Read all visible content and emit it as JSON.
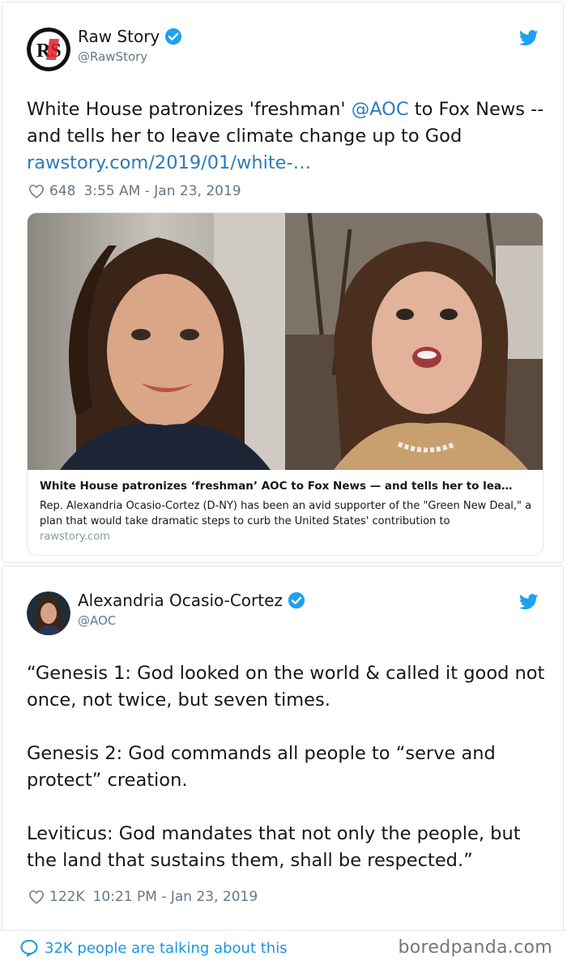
{
  "tweet1": {
    "author_name": "Raw Story",
    "author_handle": "@RawStory",
    "avatar_text": "RS",
    "text_part1": "White House patronizes 'freshman' ",
    "mention": "@AOC",
    "text_part2": " to Fox News -- and tells her to leave climate change up to God ",
    "link": "rawstory.com/2019/01/white-…",
    "likes": "648",
    "timestamp": "3:55 AM - Jan 23, 2019",
    "card": {
      "title": "White House patronizes ‘freshman’ AOC to Fox News — and tells her to lea…",
      "description": "Rep. Alexandria Ocasio-Cortez (D-NY) has been an avid supporter of the \"Green New Deal,\" a plan that would take dramatic steps to curb the United States' contribution to",
      "domain": "rawstory.com"
    }
  },
  "tweet2": {
    "author_name": "Alexandria Ocasio-Cortez",
    "author_handle": "@AOC",
    "paragraph1": "“Genesis 1: God looked on the world & called it good not once, not twice, but seven times.",
    "paragraph2": "Genesis 2: God commands all people to “serve and protect” creation.",
    "paragraph3": "Leviticus: God mandates that not only the people, but the land that sustains them, shall be respected.”",
    "likes": "122K",
    "timestamp": "10:21 PM - Jan 23, 2019"
  },
  "footer": {
    "talking": "32K people are talking about this",
    "watermark": "boredpanda.com"
  },
  "icons": {
    "verified": "verified-badge-icon",
    "bird": "twitter-bird-icon",
    "heart": "heart-icon",
    "speech": "speech-bubble-icon"
  },
  "colors": {
    "link": "#2b7bb9",
    "twitter_blue": "#1da1f2",
    "meta_gray": "#657786",
    "rawstory_red": "#e0202a"
  }
}
